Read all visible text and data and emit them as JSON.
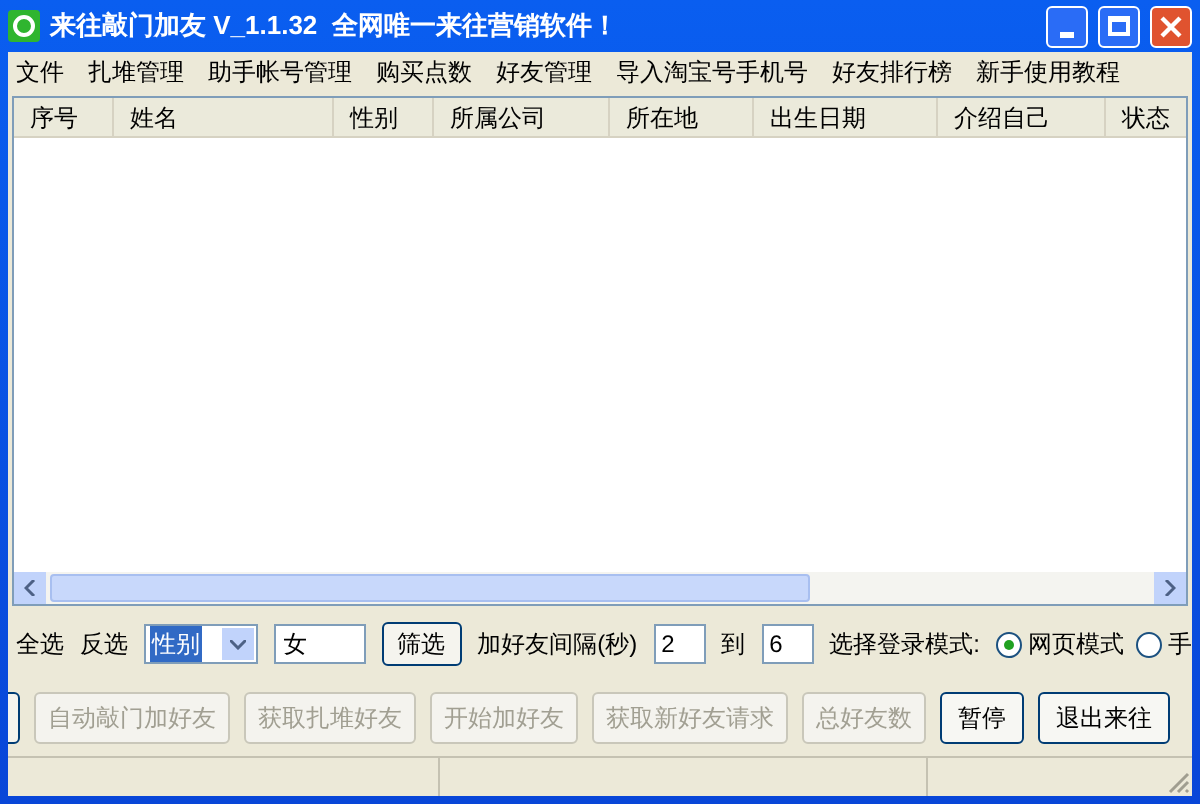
{
  "window": {
    "title": "来往敲门加友 V_1.1.32  全网唯一来往营销软件！"
  },
  "menu": [
    "文件",
    "扎堆管理",
    "助手帐号管理",
    "购买点数",
    "好友管理",
    "导入淘宝号手机号",
    "好友排行榜",
    "新手使用教程"
  ],
  "table": {
    "columns": [
      "序号",
      "姓名",
      "性别",
      "所属公司",
      "所在地",
      "出生日期",
      "介绍自己",
      "状态"
    ]
  },
  "filter": {
    "select_all": "全选",
    "invert": "反选",
    "field": "性别",
    "value": "女",
    "filter_button": "筛选",
    "interval_label": "加好友间隔(秒)",
    "interval_from": "2",
    "to_label": "到",
    "interval_to": "6",
    "mode_label": "选择登录模式:",
    "modes": [
      {
        "label": "网页模式",
        "selected": true
      },
      {
        "label": "手",
        "selected": false
      }
    ]
  },
  "buttons": [
    {
      "label": "自动敲门加好友",
      "disabled": true
    },
    {
      "label": "获取扎堆好友",
      "disabled": true
    },
    {
      "label": "开始加好友",
      "disabled": true
    },
    {
      "label": "获取新好友请求",
      "disabled": true
    },
    {
      "label": "总好友数",
      "disabled": true
    },
    {
      "label": "暂停",
      "disabled": false
    },
    {
      "label": "退出来往",
      "disabled": false
    }
  ]
}
